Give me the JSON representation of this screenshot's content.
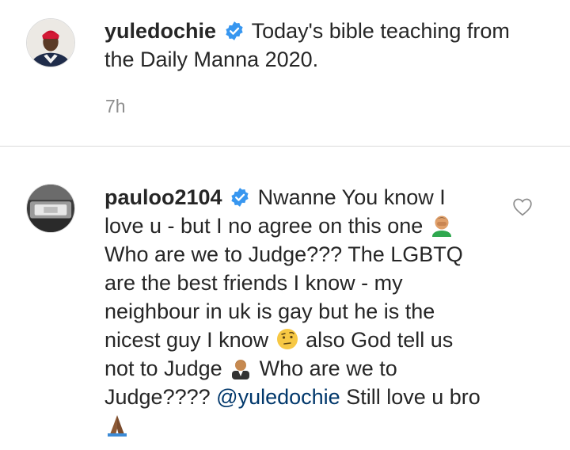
{
  "post": {
    "username": "yuledochie",
    "caption": "Today's bible teaching from the Daily Manna 2020.",
    "time": "7h"
  },
  "comment": {
    "username": "pauloo2104",
    "text_1": "Nwanne You know I love u - but I no agree on this one",
    "text_2": "Who are we to Judge??? The LGBTQ are the best friends I know - my neighbour in uk is gay but he is the nicest guy I know",
    "text_3": "also God tell us not to Judge",
    "text_4": "Who are we to Judge????",
    "mention": "@yuledochie",
    "text_5": "Still love u bro"
  },
  "icons": {
    "verified": "verified-badge-icon",
    "like": "heart-outline-icon",
    "emoji_1": "man-facepalming-emoji",
    "emoji_2": "face-with-raised-eyebrow-emoji",
    "emoji_3": "man-judge-emoji",
    "emoji_4": "folded-hands-emoji"
  },
  "colors": {
    "verified_blue": "#3897f0",
    "mention_blue": "#00376b",
    "text": "#262626",
    "muted": "#8e8e8e"
  }
}
